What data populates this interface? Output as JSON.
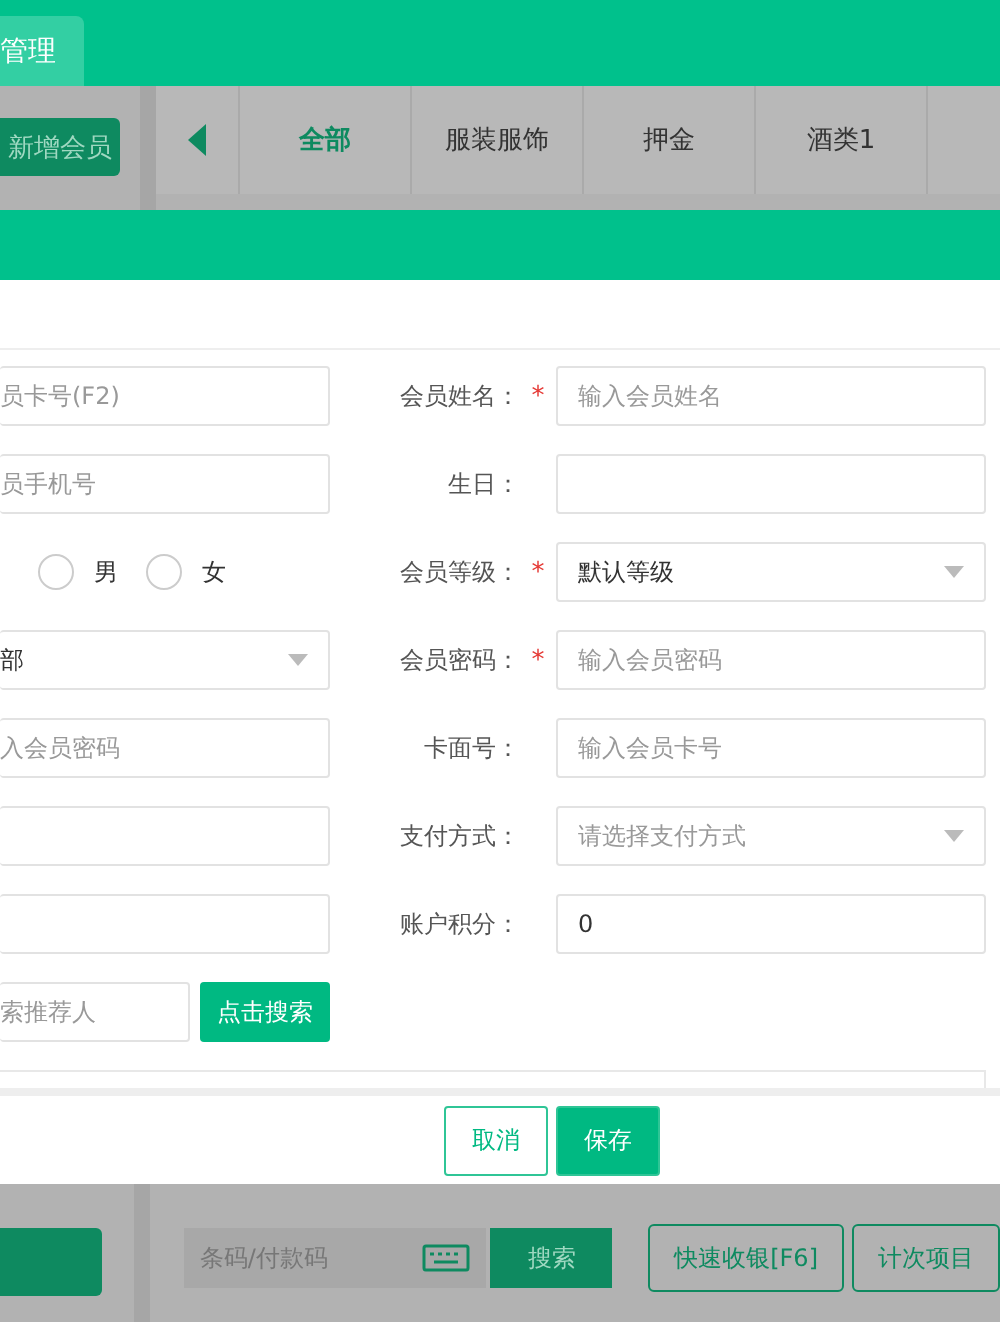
{
  "top_bar": {
    "tab": "管理"
  },
  "toolbar": {
    "add_button": "新增会员",
    "categories": [
      {
        "label": "全部",
        "selected": true
      },
      {
        "label": "服装服饰",
        "selected": false
      },
      {
        "label": "押金",
        "selected": false
      },
      {
        "label": "酒类1",
        "selected": false
      }
    ]
  },
  "dialog": {
    "left_fields": [
      {
        "kind": "input",
        "placeholder": "员卡号(F2)"
      },
      {
        "kind": "input",
        "placeholder": "员手机号"
      },
      {
        "kind": "radio",
        "options": [
          {
            "label": "男",
            "selected": false
          },
          {
            "label": "女",
            "selected": false
          }
        ]
      },
      {
        "kind": "select",
        "value": "部"
      },
      {
        "kind": "input",
        "placeholder": "入会员密码"
      },
      {
        "kind": "input"
      },
      {
        "kind": "input"
      },
      {
        "kind": "search",
        "placeholder": "索推荐人",
        "button": "点击搜索"
      }
    ],
    "right_fields": [
      {
        "label": "会员姓名：",
        "required_mark": "*",
        "kind": "input",
        "placeholder": "输入会员姓名"
      },
      {
        "label": "生日：",
        "kind": "input"
      },
      {
        "label": "会员等级：",
        "required_mark": "*",
        "kind": "select",
        "value": "默认等级"
      },
      {
        "label": "会员密码：",
        "required_mark": "*",
        "kind": "input",
        "placeholder": "输入会员密码"
      },
      {
        "label": "卡面号：",
        "kind": "input",
        "placeholder": "输入会员卡号"
      },
      {
        "label": "支付方式：",
        "kind": "select",
        "placeholder": "请选择支付方式"
      },
      {
        "label": "账户积分：",
        "kind": "input",
        "value": "0"
      }
    ],
    "cancel_button": "取消",
    "save_button": "保存"
  },
  "bottom_bar": {
    "barcode_placeholder": "条码/付款码",
    "search_button": "搜索",
    "buttons": [
      "快速收银[F6]",
      "计次项目"
    ]
  }
}
